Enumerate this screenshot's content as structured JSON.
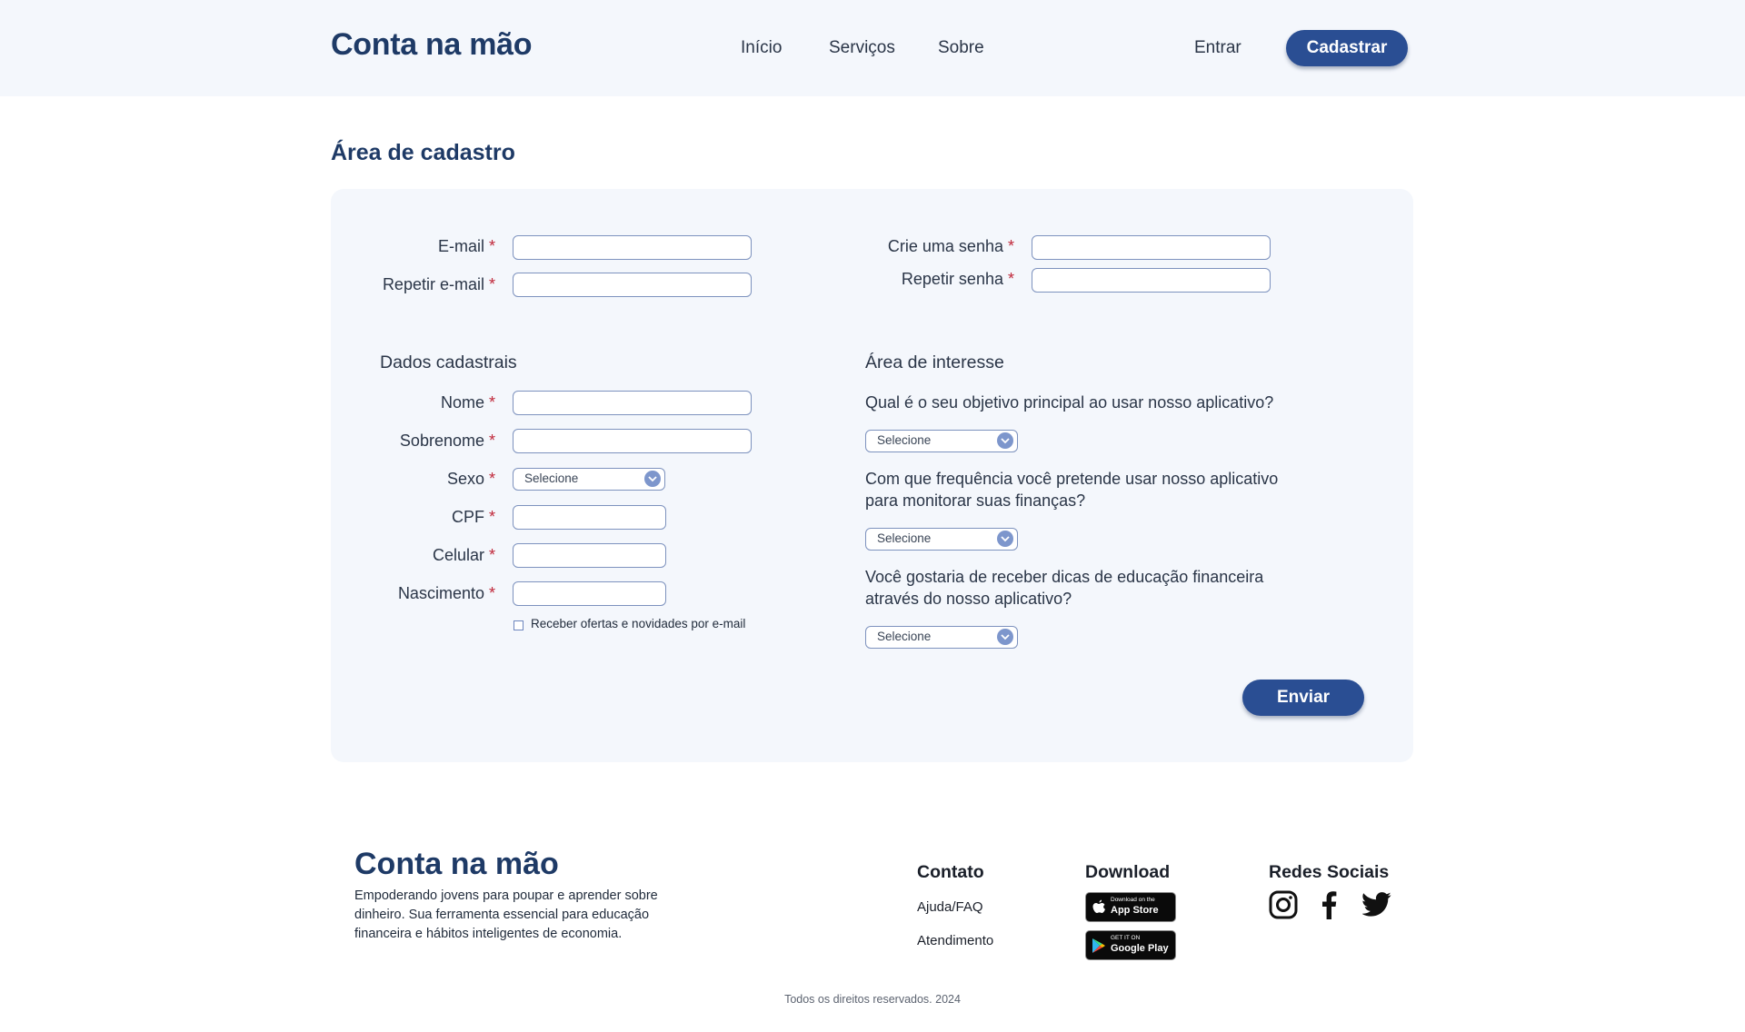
{
  "header": {
    "logo": "Conta na mão",
    "nav": [
      "Início",
      "Serviços",
      "Sobre"
    ],
    "login": "Entrar",
    "signup": "Cadastrar"
  },
  "page_title": "Área de cadastro",
  "account": {
    "email_label": "E-mail",
    "repeat_email_label": "Repetir e-mail",
    "password_label": "Crie uma senha",
    "repeat_password_label": "Repetir senha",
    "required_mark": "*"
  },
  "personal": {
    "heading": "Dados cadastrais",
    "name_label": "Nome",
    "surname_label": "Sobrenome",
    "sex_label": "Sexo",
    "sex_value": "Selecione",
    "cpf_label": "CPF",
    "phone_label": "Celular",
    "birth_label": "Nascimento",
    "offers_label": "Receber ofertas e novidades por e-mail"
  },
  "interest": {
    "heading": "Área de interesse",
    "q1": "Qual é o seu objetivo principal ao usar nosso aplicativo?",
    "q1_value": "Selecione",
    "q2_line1": "Com que frequência você pretende usar nosso aplicativo",
    "q2_line2": "para monitorar suas finanças?",
    "q2_value": "Selecione",
    "q3_line1": "Você gostaria de receber dicas de educação financeira",
    "q3_line2": "através do nosso aplicativo?",
    "q3_value": "Selecione"
  },
  "submit": "Enviar",
  "footer": {
    "logo": "Conta na mão",
    "description": "Empoderando jovens para poupar e aprender sobre dinheiro. Sua ferramenta essencial para educação financeira e hábitos inteligentes de economia.",
    "contact_heading": "Contato",
    "contact_links": [
      "Ajuda/FAQ",
      "Atendimento"
    ],
    "download_heading": "Download",
    "app_store_small": "Download on the",
    "app_store_big": "App Store",
    "google_small": "GET IT ON",
    "google_big": "Google Play",
    "social_heading": "Redes Sociais",
    "copyright": "Todos os direitos reservados. 2024"
  },
  "colors": {
    "primary": "#2a4e93",
    "title": "#1e3a66",
    "required": "#c0283a",
    "panel": "#f4f7fc"
  }
}
